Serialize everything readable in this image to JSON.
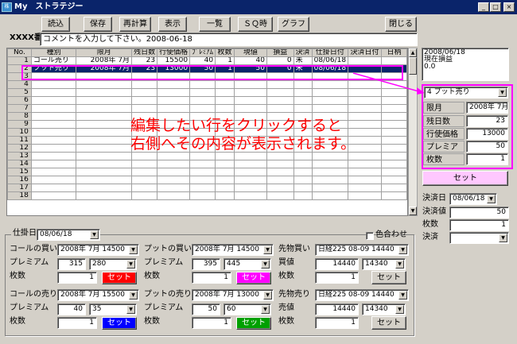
{
  "window": {
    "logo": "株",
    "title": "My　ストラテジー",
    "min": "_",
    "max": "□",
    "close": "×"
  },
  "toolbar": {
    "b1": "読込",
    "b2": "保存",
    "b3": "再計算",
    "b4": "表示",
    "b5": "一覧",
    "b6": "ＳＱ時",
    "b7": "グラフ",
    "close": "閉じる"
  },
  "header": {
    "label": "XXXX番",
    "comment": "コメントを入力して下さい。2008-06-18"
  },
  "grid": {
    "cols": [
      "No.",
      "種別",
      "限月",
      "残日数",
      "行使価格",
      "ﾌﾟﾚﾐｱﾑ",
      "枚数",
      "現値",
      "損益",
      "決済",
      "仕掛日付",
      "決済日付",
      "日柄"
    ],
    "rows": [
      {
        "no": "1",
        "type": "コール売り",
        "month": "2008年 7月",
        "days": "23",
        "strike": "15500",
        "prem": "40",
        "qty": "1",
        "cur": "40",
        "pl": "0",
        "settle": "未",
        "date": "08/06/18"
      },
      {
        "no": "2",
        "type": "プット売り",
        "month": "2008年 7月",
        "days": "23",
        "strike": "13000",
        "prem": "50",
        "qty": "1",
        "cur": "50",
        "pl": "0",
        "settle": "未",
        "date": "08/06/18"
      }
    ],
    "empty": [
      "3",
      "4",
      "5",
      "6",
      "7",
      "8",
      "9",
      "10",
      "11",
      "12",
      "13",
      "14",
      "15",
      "16",
      "17",
      "18"
    ]
  },
  "annotation": {
    "line1": "編集したい行をクリックすると",
    "line2": "右側へその内容が表示されます。"
  },
  "summary": {
    "date": "2008/06/18",
    "label": "現在損益",
    "value": "0.0"
  },
  "edit": {
    "select": "4 プット売り",
    "month_label": "限月",
    "month": "2008年 7月",
    "days_label": "残日数",
    "days": "23",
    "strike_label": "行使価格",
    "strike": "13000",
    "prem_label": "プレミアム",
    "prem": "50",
    "qty_label": "枚数",
    "qty": "1",
    "set": "セット"
  },
  "settle": {
    "date_label": "決済日",
    "date": "08/06/18",
    "price_label": "決済値",
    "price": "50",
    "qty_label": "枚数",
    "qty": "1",
    "status_label": "決済",
    "status": ""
  },
  "bottom": {
    "start_label": "仕掛日",
    "start": "08/06/18",
    "color_label": "色合わせ",
    "cb": {
      "title": "コールの買い",
      "month": "2008年 7月 14500",
      "prem_label": "プレミアム",
      "prem": "315",
      "prem2": "280",
      "qty_label": "枚数",
      "qty": "1",
      "set": "セット"
    },
    "pb": {
      "title": "プットの買い",
      "month": "2008年 7月 14500",
      "prem_label": "プレミアム",
      "prem": "395",
      "prem2": "445",
      "qty_label": "枚数",
      "qty": "1",
      "set": "セット"
    },
    "fb": {
      "title": "先物買い",
      "month": "日経225 08-09 14440",
      "price_label": "買値",
      "price": "14440",
      "price2": "14340",
      "qty_label": "枚数",
      "qty": "1",
      "set": "セット"
    },
    "cs": {
      "title": "コールの売り",
      "month": "2008年 7月 15500",
      "prem_label": "プレミアム",
      "prem": "40",
      "prem2": "35",
      "qty_label": "枚数",
      "qty": "1",
      "set": "セット"
    },
    "ps": {
      "title": "プットの売り",
      "month": "2008年 7月 13000",
      "prem_label": "プレミアム",
      "prem": "50",
      "prem2": "60",
      "qty_label": "枚数",
      "qty": "1",
      "set": "セット"
    },
    "fs": {
      "title": "先物売り",
      "month": "日経225 08-09 14440",
      "price_label": "売値",
      "price": "14440",
      "price2": "14340",
      "qty_label": "枚数",
      "qty": "1",
      "set": "セット"
    }
  },
  "colors": {
    "highlight": "#ff00ff",
    "annotation": "#ff0000",
    "set_cb": "#ff0000",
    "set_pb": "#ff00ff",
    "set_cs": "#0000ff",
    "set_ps": "#00a000",
    "edit_set": "#ffc8ff"
  }
}
